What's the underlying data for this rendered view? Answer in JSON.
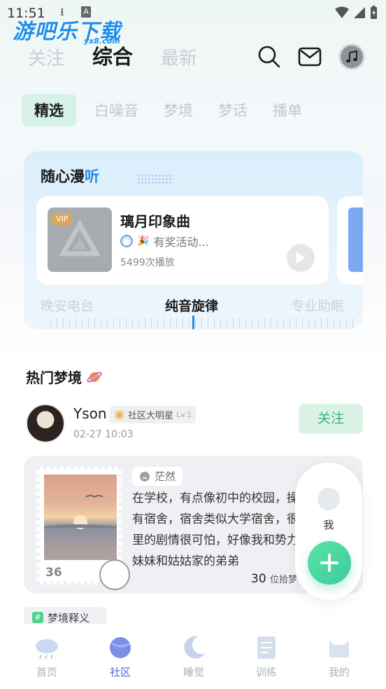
{
  "status_bar": {
    "time": "11:51",
    "a_label": "A"
  },
  "watermark": {
    "text": "游吧乐下载",
    "sub": "yx8.com"
  },
  "top_tabs": [
    {
      "label": "关注"
    },
    {
      "label": "综合",
      "active": true
    },
    {
      "label": "最新"
    }
  ],
  "top_actions": [
    "search-icon",
    "mail-icon",
    "music-icon"
  ],
  "chips": [
    {
      "label": "精选",
      "active": true
    },
    {
      "label": "白噪音"
    },
    {
      "label": "梦境"
    },
    {
      "label": "梦话"
    },
    {
      "label": "播单"
    }
  ],
  "listen_card": {
    "title_a": "随心漫",
    "title_b": "听",
    "track": {
      "vip": "VIP",
      "name": "璃月印象曲",
      "sub": "有奖活动...",
      "plays": "5499次播放"
    },
    "radio_tabs": [
      {
        "label": "晚安电台"
      },
      {
        "label": "纯音旋律",
        "active": true
      },
      {
        "label": "专业助眠"
      }
    ]
  },
  "hot": {
    "title": "热门梦境",
    "post": {
      "username": "Yson",
      "badge": "社区大明星",
      "badge_level": "Lv.1",
      "time": "02-27 10:03",
      "follow_label": "关注",
      "mood": "茫然",
      "text": "在学校，有点像初中的校园，操场，又有宿舍，宿舍类似大学宿舍，很大。梦里的剧情很可怕，好像我和势力针对，妹妹和姑姑家的弟弟",
      "stamp_number": "36",
      "count": "30",
      "count_suffix": "位拾梦"
    },
    "topic": "梦境释义"
  },
  "float_panel": {
    "me_label": "我"
  },
  "bottom_nav": [
    {
      "label": "首页",
      "icon": "cloud-rain-icon"
    },
    {
      "label": "社区",
      "icon": "planet-icon",
      "active": true
    },
    {
      "label": "睡觉",
      "icon": "moon-icon"
    },
    {
      "label": "训练",
      "icon": "notebook-icon"
    },
    {
      "label": "我的",
      "icon": "cat-icon"
    }
  ],
  "colors": {
    "accent_green": "#37b27a",
    "accent_blue": "#2e86e0",
    "nav_active": "#4f67d8"
  }
}
